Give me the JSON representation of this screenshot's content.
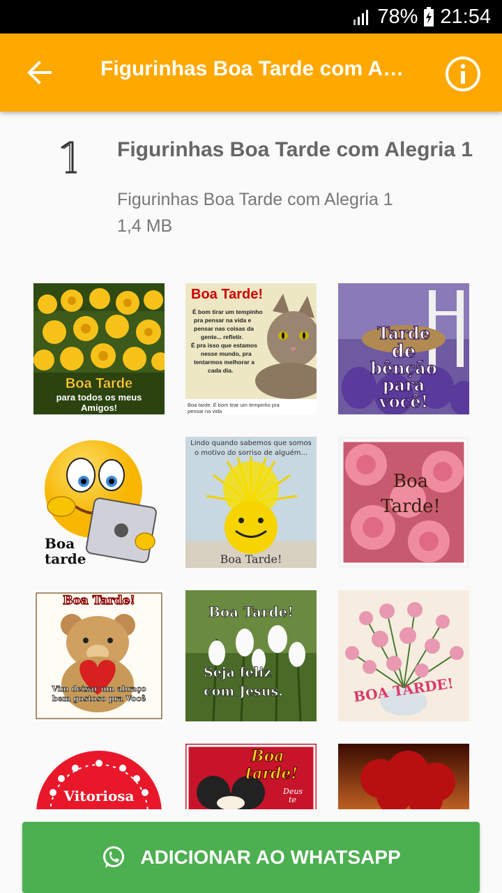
{
  "status": {
    "battery": "78%",
    "time": "21:54"
  },
  "appbar": {
    "title": "Figurinhas Boa Tarde com Al…",
    "back_icon": "arrow-back-icon",
    "info_icon": "info-icon"
  },
  "pack": {
    "number": "1",
    "title": "Figurinhas Boa Tarde com Alegria 1",
    "subtitle": "Figurinhas Boa Tarde com Alegria 1",
    "size": "1,4 MB"
  },
  "stickers": {
    "s1": {
      "line1": "Boa Tarde",
      "line2": "para todos os meus",
      "line3": "Amigos!"
    },
    "s2": {
      "head": "Boa Tarde!",
      "body1": "É bom tirar um tempinho",
      "body2": "pra pensar na vida e",
      "body3": "pensar nas coisas da",
      "body4": "gente... refletir.",
      "body5": "É pra isso que estamos",
      "body6": "nesse mundo, pra",
      "body7": "tentarmos melhorar a",
      "body8": "cada dia.",
      "caption1": "Boa tarde. É bom tirar um tempinho pra",
      "caption2": "pensar na vida"
    },
    "s3": {
      "l1": "Tarde",
      "l2": "de",
      "l3": "bênção",
      "l4": "para",
      "l5": "você!"
    },
    "s4": {
      "l1": "Boa",
      "l2": "tarde"
    },
    "s5": {
      "top1": "Lindo quando sabemos que somos",
      "top2": "o motivo do sorriso de alguém...",
      "bottom": "Boa Tarde!"
    },
    "s6": {
      "l1": "Boa",
      "l2": "Tarde!"
    },
    "s7": {
      "top": "Boa Tarde!",
      "b1": "Vim deixar um abraço",
      "b2": "bem gostoso pra Você"
    },
    "s8": {
      "top": "Boa Tarde!",
      "b1": "Seja feliz",
      "b2": "com Jesus."
    },
    "s9": {
      "text": "BOA TARDE!"
    },
    "s10": {
      "text": "Vitoriosa"
    },
    "s11": {
      "l1": "Boa",
      "l2": "tarde!",
      "side1": "Deus",
      "side2": "te"
    }
  },
  "button": {
    "label": "ADICIONAR AO WHATSAPP",
    "icon": "whatsapp-icon"
  },
  "colors": {
    "appbar": "#ffa800",
    "button": "#4caf50",
    "statusbar": "#000000"
  }
}
